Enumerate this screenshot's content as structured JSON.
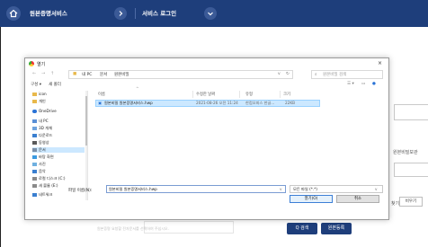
{
  "nav": {
    "service_name": "원본증명서비스",
    "login_label": "서비스 로그인"
  },
  "page": {
    "side_label": "원본비밀보관",
    "browse_button": "찾기",
    "reset_button": "비우기",
    "placeholder": "원본증명 요청할 전자문서를 선택하여 주십시오.",
    "search_button": "Q 검색",
    "register_button": "원본등록"
  },
  "dialog": {
    "title": "열기",
    "close_symbol": "×",
    "address": [
      "내 PC",
      "문서",
      "원본비밀"
    ],
    "search_placeholder": "원본비밀 검색",
    "organize_label": "구성 ▾",
    "new_folder_label": "새 폴더",
    "sidebar": [
      {
        "label": "icon",
        "color": "#e8b84a"
      },
      {
        "label": "개인",
        "color": "#e8b84a"
      },
      {
        "label": "OneDrive",
        "color": "#2a73d6"
      },
      {
        "label": "내 PC",
        "color": "#5a8fd6"
      },
      {
        "label": "3D 개체",
        "color": "#6fa3dd"
      },
      {
        "label": "다운로드",
        "color": "#3a7fd0"
      },
      {
        "label": "동영상",
        "color": "#5a5a5a"
      },
      {
        "label": "문서",
        "color": "#7b8fa8"
      },
      {
        "label": "바탕 화면",
        "color": "#3a9ae0"
      },
      {
        "label": "사진",
        "color": "#6fb0e0"
      },
      {
        "label": "음악",
        "color": "#3a7fd0"
      },
      {
        "label": "로컬 디스크 (C:)",
        "color": "#8a8a8a"
      },
      {
        "label": "새 볼륨 (E:)",
        "color": "#8a8a8a"
      },
      {
        "label": "네트워크",
        "color": "#3a7fd0"
      }
    ],
    "columns": [
      "이름",
      "수정한 날짜",
      "유형",
      "크기"
    ],
    "file": {
      "name": "원본비밀 원본증명서비스.hwp",
      "date": "2021-08-26 오전 11:24",
      "type": "한컴오피스 한글...",
      "size": "22KB"
    },
    "filename_label": "파일 이름(N):",
    "filename_value": "원본비밀 원본증명서비스.hwp",
    "filetype_value": "모든 파일 (*.*)",
    "open_button": "열기(O)",
    "cancel_button": "취소"
  }
}
